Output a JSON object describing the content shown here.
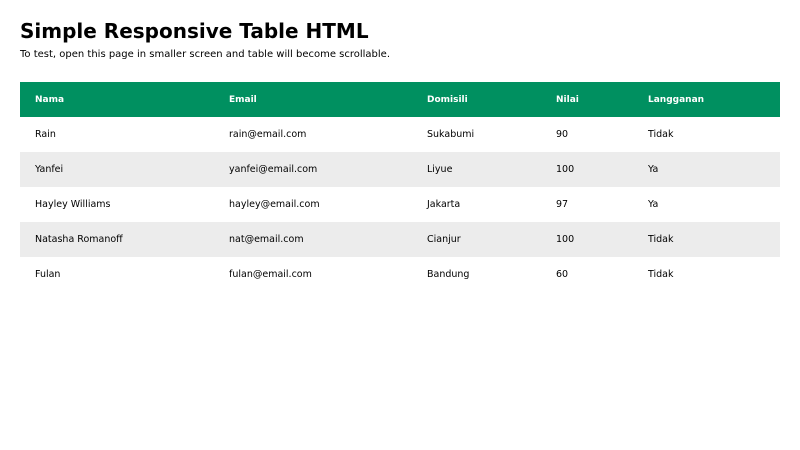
{
  "header": {
    "title": "Simple Responsive Table HTML",
    "subtitle": "To test, open this page in smaller screen and table will become scrollable."
  },
  "table": {
    "columns": [
      "Nama",
      "Email",
      "Domisili",
      "Nilai",
      "Langganan"
    ],
    "rows": [
      [
        "Rain",
        "rain@email.com",
        "Sukabumi",
        "90",
        "Tidak"
      ],
      [
        "Yanfei",
        "yanfei@email.com",
        "Liyue",
        "100",
        "Ya"
      ],
      [
        "Hayley Williams",
        "hayley@email.com",
        "Jakarta",
        "97",
        "Ya"
      ],
      [
        "Natasha Romanoff",
        "nat@email.com",
        "Cianjur",
        "100",
        "Tidak"
      ],
      [
        "Fulan",
        "fulan@email.com",
        "Bandung",
        "60",
        "Tidak"
      ]
    ]
  },
  "colors": {
    "header_bg": "#009060",
    "header_text": "#ffffff",
    "stripe_bg": "#ececec"
  }
}
